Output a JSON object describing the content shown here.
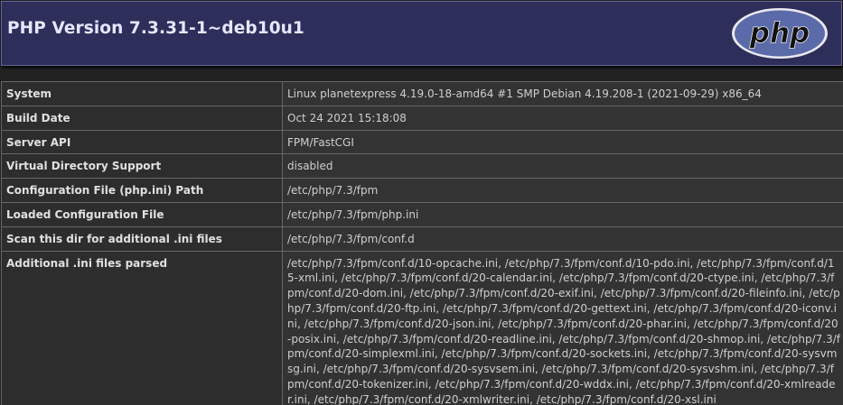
{
  "header": {
    "title": "PHP Version 7.3.31-1~deb10u1",
    "logo_text": "php",
    "colors": {
      "header_bg": "#2e2e5a",
      "logo_fill": "#5b6aa8",
      "logo_text": "#111111"
    }
  },
  "rows": [
    {
      "key": "System",
      "value": "Linux planetexpress 4.19.0-18-amd64 #1 SMP Debian 4.19.208-1 (2021-09-29) x86_64"
    },
    {
      "key": "Build Date",
      "value": "Oct 24 2021 15:18:08"
    },
    {
      "key": "Server API",
      "value": "FPM/FastCGI"
    },
    {
      "key": "Virtual Directory Support",
      "value": "disabled"
    },
    {
      "key": "Configuration File (php.ini) Path",
      "value": "/etc/php/7.3/fpm"
    },
    {
      "key": "Loaded Configuration File",
      "value": "/etc/php/7.3/fpm/php.ini"
    },
    {
      "key": "Scan this dir for additional .ini files",
      "value": "/etc/php/7.3/fpm/conf.d"
    },
    {
      "key": "Additional .ini files parsed",
      "value": "/etc/php/7.3/fpm/conf.d/10-opcache.ini, /etc/php/7.3/fpm/conf.d/10-pdo.ini, /etc/php/7.3/fpm/conf.d/15-xml.ini, /etc/php/7.3/fpm/conf.d/20-calendar.ini, /etc/php/7.3/fpm/conf.d/20-ctype.ini, /etc/php/7.3/fpm/conf.d/20-dom.ini, /etc/php/7.3/fpm/conf.d/20-exif.ini, /etc/php/7.3/fpm/conf.d/20-fileinfo.ini, /etc/php/7.3/fpm/conf.d/20-ftp.ini, /etc/php/7.3/fpm/conf.d/20-gettext.ini, /etc/php/7.3/fpm/conf.d/20-iconv.ini, /etc/php/7.3/fpm/conf.d/20-json.ini, /etc/php/7.3/fpm/conf.d/20-phar.ini, /etc/php/7.3/fpm/conf.d/20-posix.ini, /etc/php/7.3/fpm/conf.d/20-readline.ini, /etc/php/7.3/fpm/conf.d/20-shmop.ini, /etc/php/7.3/fpm/conf.d/20-simplexml.ini, /etc/php/7.3/fpm/conf.d/20-sockets.ini, /etc/php/7.3/fpm/conf.d/20-sysvmsg.ini, /etc/php/7.3/fpm/conf.d/20-sysvsem.ini, /etc/php/7.3/fpm/conf.d/20-sysvshm.ini, /etc/php/7.3/fpm/conf.d/20-tokenizer.ini, /etc/php/7.3/fpm/conf.d/20-wddx.ini, /etc/php/7.3/fpm/conf.d/20-xmlreader.ini, /etc/php/7.3/fpm/conf.d/20-xmlwriter.ini, /etc/php/7.3/fpm/conf.d/20-xsl.ini"
    }
  ]
}
